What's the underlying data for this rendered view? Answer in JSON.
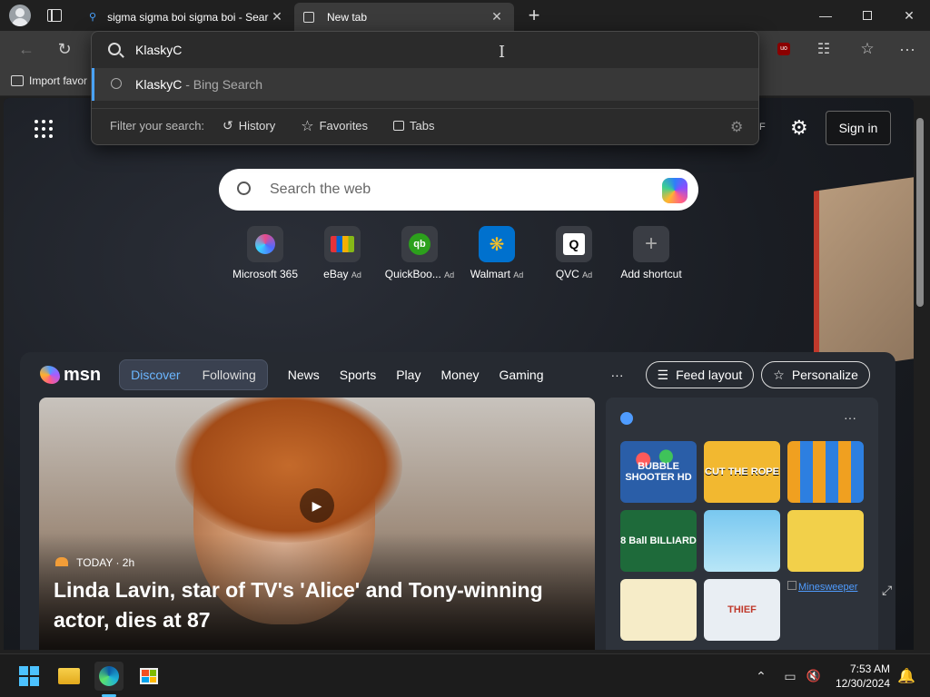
{
  "tabs": [
    {
      "title": "sigma sigma boi sigma boi - Sear",
      "active": false
    },
    {
      "title": "New tab",
      "active": true
    }
  ],
  "favorites_bar": {
    "import_label": "Import favor"
  },
  "omnibox": {
    "input_value": "KlaskyC",
    "suggestion_query": "KlaskyC",
    "suggestion_suffix": " - Bing Search",
    "filter_label": "Filter your search:",
    "filters": [
      "History",
      "Favorites",
      "Tabs"
    ]
  },
  "page": {
    "partial_label": "F",
    "sign_in": "Sign in",
    "search_placeholder": "Search the web",
    "shortcuts": [
      {
        "name": "Microsoft 365",
        "ad": ""
      },
      {
        "name": "eBay",
        "ad": "Ad"
      },
      {
        "name": "QuickBoo...",
        "ad": "Ad"
      },
      {
        "name": "Walmart",
        "ad": "Ad"
      },
      {
        "name": "QVC",
        "ad": "Ad"
      },
      {
        "name": "Add shortcut",
        "ad": ""
      }
    ]
  },
  "msn": {
    "logo": "msn",
    "pill": [
      "Discover",
      "Following"
    ],
    "nav": [
      "News",
      "Sports",
      "Play",
      "Money",
      "Gaming"
    ],
    "more": "···",
    "feed_layout": "Feed layout",
    "personalize": "Personalize",
    "hero": {
      "source": "TODAY · 2h",
      "title": "Linda Lavin, star of TV's 'Alice' and Tony-winning actor, dies at 87"
    },
    "games": [
      {
        "label": "BUBBLE SHOOTER HD",
        "color": "#2a5ea8"
      },
      {
        "label": "CUT THE ROPE",
        "color": "#f2b830"
      },
      {
        "label": "",
        "color": "#1f3a7a"
      },
      {
        "label": "8 Ball BILLIARD",
        "color": "#1e6a3a"
      },
      {
        "label": "",
        "color": "#79c8f0"
      },
      {
        "label": "",
        "color": "#f2d04a"
      },
      {
        "label": "",
        "color": "#f6ecc8"
      },
      {
        "label": "THIEF",
        "color": "#e9eef3"
      }
    ],
    "broken_image_text": "Minesweeper"
  },
  "taskbar": {
    "time": "7:53 AM",
    "date": "12/30/2024"
  },
  "colors": {
    "accent": "#4aa3ff",
    "tab_active": "#3b3b3b",
    "page_dark": "#121418"
  }
}
